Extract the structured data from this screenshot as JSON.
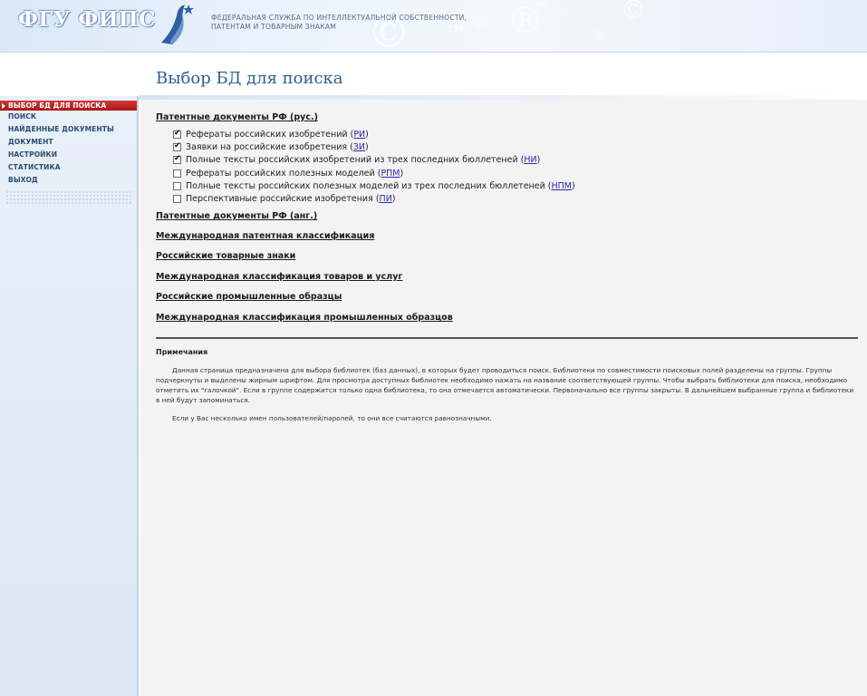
{
  "header": {
    "brand": "ФГУ ФИПС",
    "org_line1": "ФЕДЕРАЛЬНАЯ СЛУЖБА ПО ИНТЕЛЛЕКТУАЛЬНОЙ СОБСТВЕННОСТИ,",
    "org_line2": "ПАТЕНТАМ И ТОВАРНЫМ ЗНАКАМ"
  },
  "page_title": "Выбор БД для поиска",
  "sidebar": {
    "items": [
      {
        "label": "ВЫБОР БД ДЛЯ ПОИСКА",
        "active": true
      },
      {
        "label": "ПОИСК"
      },
      {
        "label": "НАЙДЕННЫЕ ДОКУМЕНТЫ"
      },
      {
        "label": "ДОКУМЕНТ"
      },
      {
        "label": "НАСТРОЙКИ"
      },
      {
        "label": "СТАТИСТИКА"
      },
      {
        "label": "ВЫХОД"
      }
    ]
  },
  "groups": [
    {
      "label": "Патентные документы РФ (рус.)"
    },
    {
      "label": "Патентные документы РФ (анг.)"
    },
    {
      "label": "Международная патентная классификация"
    },
    {
      "label": "Российские товарные знаки"
    },
    {
      "label": "Международная классификация товаров и услуг"
    },
    {
      "label": "Российские промышленные образцы"
    },
    {
      "label": "Международная классификация промышленных образцов"
    }
  ],
  "databases": [
    {
      "label": "Рефераты российских изобретений",
      "code": "РИ",
      "checked": true
    },
    {
      "label": "Заявки на российские изобретения",
      "code": "ЗИ",
      "checked": true
    },
    {
      "label": "Полные тексты российских изобретений из трех последних бюллетеней",
      "code": "НИ",
      "checked": true
    },
    {
      "label": "Рефераты российских полезных моделей",
      "code": "РПМ",
      "checked": false
    },
    {
      "label": "Полные тексты российских полезных моделей из трех последних бюллетеней",
      "code": "НПМ",
      "checked": false
    },
    {
      "label": "Перспективные российские изобретения",
      "code": "ПИ",
      "checked": false
    }
  ],
  "notes": {
    "title": "Примечания",
    "p1": "Данная страница предназначена для выбора библиотек (баз данных), в которых будет проводиться поиск. Библиотеки по совместимости поисковых полей разделены на группы. Группы подчеркнуты и выделены жирным шрифтом. Для просмотра доступных библиотек необходимо нажать на название соответствующей группы. Чтобы выбрать библиотеки для поиска, необходимо отметить их \"галочкой\". Если в группе содержится только одна библиотека, то она отмечается автоматически. Первоначально все группы закрыты. В дальнейшем выбранные группа и библиотеки в ней будут запоминаться.",
    "p2": "Если у Вас несколько имен пользователей/паролей, то они все считаются равнозначными."
  },
  "colors": {
    "accent": "#2f5d8f",
    "active_menu": "#b81f1f",
    "link": "#2a2ab0"
  }
}
